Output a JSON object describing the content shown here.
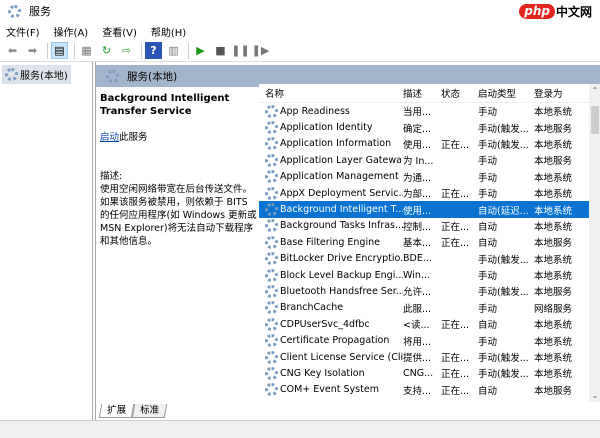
{
  "window": {
    "title": "服务",
    "logo": "php中文网",
    "logo_php": "php",
    "logo_cn": "中文网"
  },
  "menu": [
    "文件(F)",
    "操作(A)",
    "查看(V)",
    "帮助(H)"
  ],
  "toolbar": [
    "back",
    "forward",
    "show-hide-tree",
    "properties",
    "refresh",
    "export",
    "help",
    "show-hide-action",
    "start",
    "stop",
    "pause",
    "restart"
  ],
  "tree": {
    "node": "服务(本地)"
  },
  "panel": {
    "header": "服务(本地)"
  },
  "details": {
    "service_name": "Background Intelligent Transfer Service",
    "start_link": "启动",
    "start_suffix": "此服务",
    "desc_label": "描述:",
    "description": "使用空闲网络带宽在后台传送文件。如果该服务被禁用，则依赖于 BITS 的任何应用程序(如 Windows 更新或 MSN Explorer)将无法自动下载程序和其他信息。"
  },
  "columns": [
    "名称",
    "描述",
    "状态",
    "启动类型",
    "登录为"
  ],
  "rows": [
    [
      "App Readiness",
      "当用...",
      "",
      "手动",
      "本地系统"
    ],
    [
      "Application Identity",
      "确定...",
      "",
      "手动(触发...",
      "本地服务"
    ],
    [
      "Application Information",
      "使用...",
      "正在...",
      "手动(触发...",
      "本地系统"
    ],
    [
      "Application Layer Gatewa...",
      "为 In...",
      "",
      "手动",
      "本地服务"
    ],
    [
      "Application Management",
      "为通...",
      "",
      "手动",
      "本地系统"
    ],
    [
      "AppX Deployment Servic...",
      "为部...",
      "正在...",
      "手动",
      "本地系统"
    ],
    [
      "Background Intelligent T...",
      "使用...",
      "",
      "自动(延迟...",
      "本地系统"
    ],
    [
      "Background Tasks Infras...",
      "控制...",
      "正在...",
      "自动",
      "本地系统"
    ],
    [
      "Base Filtering Engine",
      "基本...",
      "正在...",
      "自动",
      "本地服务"
    ],
    [
      "BitLocker Drive Encryptio...",
      "BDE...",
      "",
      "手动(触发...",
      "本地系统"
    ],
    [
      "Block Level Backup Engi...",
      "Win...",
      "",
      "手动",
      "本地系统"
    ],
    [
      "Bluetooth Handsfree Ser...",
      "允许...",
      "",
      "手动(触发...",
      "本地服务"
    ],
    [
      "BranchCache",
      "此服...",
      "",
      "手动",
      "网络服务"
    ],
    [
      "CDPUserSvc_4dfbc",
      "<读...",
      "正在...",
      "自动",
      "本地系统"
    ],
    [
      "Certificate Propagation",
      "将用...",
      "",
      "手动",
      "本地系统"
    ],
    [
      "Client License Service (Cli...",
      "提供...",
      "正在...",
      "手动(触发...",
      "本地系统"
    ],
    [
      "CNG Key Isolation",
      "CNG...",
      "正在...",
      "手动(触发...",
      "本地系统"
    ],
    [
      "COM+ Event System",
      "支持...",
      "正在...",
      "自动",
      "本地服务"
    ]
  ],
  "selected_row": 6,
  "tabs": [
    "扩展",
    "标准"
  ]
}
